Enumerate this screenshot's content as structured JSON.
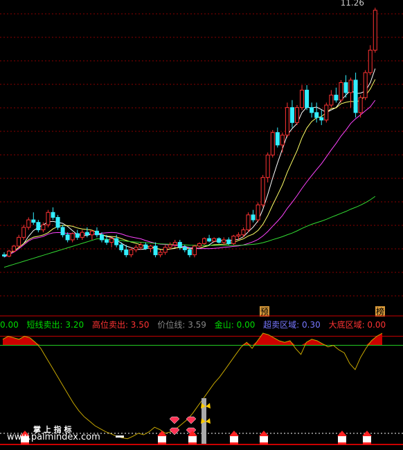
{
  "chart_data": [
    {
      "type": "candlestick",
      "panel": "price",
      "last_price_label": "11.26",
      "marker_labels": [
        "预",
        "榜"
      ],
      "trend_note": "long uptrend from ~0.4 to 11.26",
      "candles": [
        [
          2.1,
          2.2,
          2.0,
          2.05
        ],
        [
          2.05,
          2.3,
          2.0,
          2.25
        ],
        [
          2.25,
          2.5,
          2.2,
          2.45
        ],
        [
          2.45,
          2.9,
          2.4,
          2.8
        ],
        [
          2.8,
          3.3,
          2.7,
          3.2
        ],
        [
          3.2,
          3.6,
          3.1,
          3.5
        ],
        [
          3.5,
          3.8,
          3.3,
          3.4
        ],
        [
          3.4,
          3.5,
          3.0,
          3.1
        ],
        [
          3.1,
          3.4,
          3.0,
          3.3
        ],
        [
          3.3,
          3.9,
          3.2,
          3.8
        ],
        [
          3.8,
          4.0,
          3.5,
          3.6
        ],
        [
          3.6,
          3.7,
          3.1,
          3.2
        ],
        [
          3.2,
          3.3,
          2.8,
          2.9
        ],
        [
          2.9,
          3.0,
          2.6,
          2.7
        ],
        [
          2.7,
          3.0,
          2.6,
          2.95
        ],
        [
          2.95,
          3.1,
          2.7,
          2.8
        ],
        [
          2.8,
          3.1,
          2.7,
          3.0
        ],
        [
          3.0,
          3.2,
          2.8,
          2.9
        ],
        [
          2.9,
          3.1,
          2.7,
          3.05
        ],
        [
          3.05,
          3.2,
          2.8,
          2.9
        ],
        [
          2.9,
          3.0,
          2.6,
          2.7
        ],
        [
          2.7,
          2.9,
          2.5,
          2.6
        ],
        [
          2.6,
          2.8,
          2.4,
          2.75
        ],
        [
          2.75,
          2.9,
          2.4,
          2.5
        ],
        [
          2.5,
          2.6,
          2.2,
          2.3
        ],
        [
          2.3,
          2.5,
          2.0,
          2.1
        ],
        [
          2.1,
          2.4,
          2.0,
          2.3
        ],
        [
          2.3,
          2.5,
          2.2,
          2.4
        ],
        [
          2.4,
          2.6,
          2.3,
          2.5
        ],
        [
          2.5,
          2.6,
          2.3,
          2.35
        ],
        [
          2.35,
          2.5,
          2.2,
          2.45
        ],
        [
          2.45,
          2.6,
          2.0,
          2.1
        ],
        [
          2.1,
          2.3,
          2.0,
          2.2
        ],
        [
          2.2,
          2.5,
          2.1,
          2.4
        ],
        [
          2.4,
          2.6,
          2.3,
          2.5
        ],
        [
          2.5,
          2.7,
          2.4,
          2.6
        ],
        [
          2.6,
          2.7,
          2.3,
          2.4
        ],
        [
          2.4,
          2.5,
          2.2,
          2.3
        ],
        [
          2.3,
          2.4,
          2.0,
          2.1
        ],
        [
          2.1,
          2.5,
          2.0,
          2.45
        ],
        [
          2.45,
          2.6,
          2.4,
          2.55
        ],
        [
          2.55,
          2.8,
          2.5,
          2.75
        ],
        [
          2.75,
          2.9,
          2.6,
          2.65
        ],
        [
          2.65,
          2.8,
          2.6,
          2.75
        ],
        [
          2.75,
          2.8,
          2.55,
          2.6
        ],
        [
          2.6,
          2.8,
          2.5,
          2.7
        ],
        [
          2.7,
          2.8,
          2.5,
          2.55
        ],
        [
          2.55,
          2.9,
          2.5,
          2.85
        ],
        [
          2.85,
          3.0,
          2.7,
          2.9
        ],
        [
          2.9,
          3.2,
          2.8,
          3.1
        ],
        [
          3.1,
          3.8,
          3.0,
          3.7
        ],
        [
          3.7,
          3.9,
          3.4,
          3.5
        ],
        [
          3.5,
          4.2,
          3.4,
          4.1
        ],
        [
          4.1,
          5.3,
          4.0,
          5.2
        ],
        [
          5.2,
          6.2,
          5.0,
          6.1
        ],
        [
          6.1,
          7.1,
          6.0,
          7.0
        ],
        [
          7.0,
          7.2,
          6.4,
          6.5
        ],
        [
          6.5,
          7.0,
          6.2,
          6.9
        ],
        [
          6.9,
          8.2,
          6.8,
          8.0
        ],
        [
          8.0,
          8.3,
          7.2,
          7.4
        ],
        [
          7.4,
          8.1,
          7.3,
          8.0
        ],
        [
          8.0,
          8.9,
          7.9,
          8.7
        ],
        [
          8.7,
          8.9,
          7.9,
          8.0
        ],
        [
          8.0,
          8.2,
          7.6,
          7.8
        ],
        [
          7.8,
          8.2,
          7.4,
          7.6
        ],
        [
          7.6,
          7.9,
          7.3,
          7.5
        ],
        [
          7.5,
          8.2,
          7.4,
          8.1
        ],
        [
          8.1,
          8.7,
          8.0,
          8.5
        ],
        [
          8.5,
          8.8,
          8.2,
          8.3
        ],
        [
          8.3,
          9.1,
          8.2,
          9.0
        ],
        [
          9.0,
          9.3,
          8.4,
          8.6
        ],
        [
          8.6,
          9.2,
          8.0,
          9.1
        ],
        [
          9.1,
          9.4,
          7.6,
          7.8
        ],
        [
          7.8,
          8.5,
          7.6,
          8.4
        ],
        [
          8.4,
          9.5,
          8.3,
          9.4
        ],
        [
          9.4,
          10.5,
          9.3,
          10.3
        ],
        [
          10.3,
          12.0,
          10.2,
          11.9
        ]
      ],
      "ma_lines": [
        {
          "name": "MA5",
          "color": "#ffffff"
        },
        {
          "name": "MA10",
          "color": "#ffff66"
        },
        {
          "name": "MA20",
          "color": "#ff44ff"
        },
        {
          "name": "MA60",
          "color": "#33dd33"
        }
      ]
    },
    {
      "type": "line",
      "panel": "indicator",
      "legend": [
        {
          "label": "0.00",
          "color": "#00dd00"
        },
        {
          "label": "短线卖出: 3.20",
          "color": "#00dd00"
        },
        {
          "label": "高位卖出: 3.50",
          "color": "#ff3333"
        },
        {
          "label": "价位线: 3.59",
          "color": "#888888"
        },
        {
          "label": "金山: 0.00",
          "color": "#00dd00"
        },
        {
          "label": "超卖区域: 0.30",
          "color": "#7777ff"
        },
        {
          "label": "大底区域: 0.00",
          "color": "#ff3333"
        }
      ],
      "ylim": [
        0,
        3.6
      ],
      "line_color": "#c8a800",
      "values": [
        3.4,
        3.5,
        3.45,
        3.4,
        3.5,
        3.45,
        3.3,
        3.1,
        2.8,
        2.5,
        2.2,
        1.9,
        1.6,
        1.3,
        1.05,
        0.85,
        0.7,
        0.55,
        0.45,
        0.35,
        0.28,
        0.2,
        0.15,
        0.12,
        0.2,
        0.3,
        0.25,
        0.35,
        0.5,
        0.42,
        0.3,
        0.35,
        0.45,
        0.6,
        0.75,
        0.95,
        1.2,
        1.45,
        1.7,
        1.95,
        2.15,
        2.4,
        2.65,
        2.9,
        3.15,
        3.3,
        3.1,
        3.35,
        3.6,
        3.55,
        3.45,
        3.35,
        3.3,
        3.35,
        3.1,
        2.9,
        3.3,
        3.4,
        3.35,
        3.25,
        3.15,
        3.2,
        3.05,
        2.95,
        2.6,
        2.4,
        2.8,
        3.1,
        3.35,
        3.5,
        3.6
      ],
      "reference_lines": {
        "short_sell": 3.2,
        "high_sell": 3.5,
        "oversold": 0.3
      }
    }
  ],
  "watermark": {
    "title": "掌 上 指 标",
    "url": "www.palmindex.com"
  }
}
